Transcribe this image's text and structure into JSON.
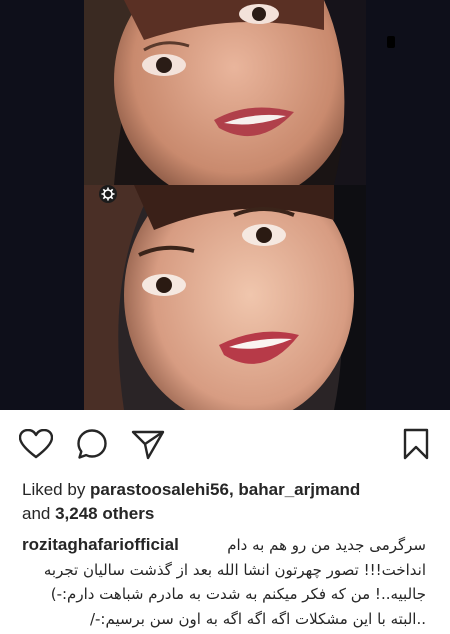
{
  "post": {
    "likes_prefix": "Liked by ",
    "liker_1": "parastoosalehi56",
    "separator": ", ",
    "liker_2": "bahar_arjmand",
    "and_word": "and ",
    "others": "3,248 others",
    "username": "rozitaghafariofficial",
    "caption_lines": [
      "سرگرمی جدید من رو هم به دام",
      "انداخت!!! تصور چهرتون انشا الله بعد از گذشت سالیان تجربه",
      "جالبیه..! من که فکر میکنم به شدت به مادرم شباهت دارم:-)",
      "..البته با این مشکلات اگه اگه اگه به اون سن برسیم:-/"
    ]
  },
  "icons": {
    "like": "heart-icon",
    "comment": "comment-bubble-icon",
    "share": "paper-plane-icon",
    "save": "bookmark-icon",
    "badge": "gear-badge-icon"
  },
  "colors": {
    "photo_background": "#0e0f1a",
    "text": "#262626",
    "icon": "#262626"
  }
}
